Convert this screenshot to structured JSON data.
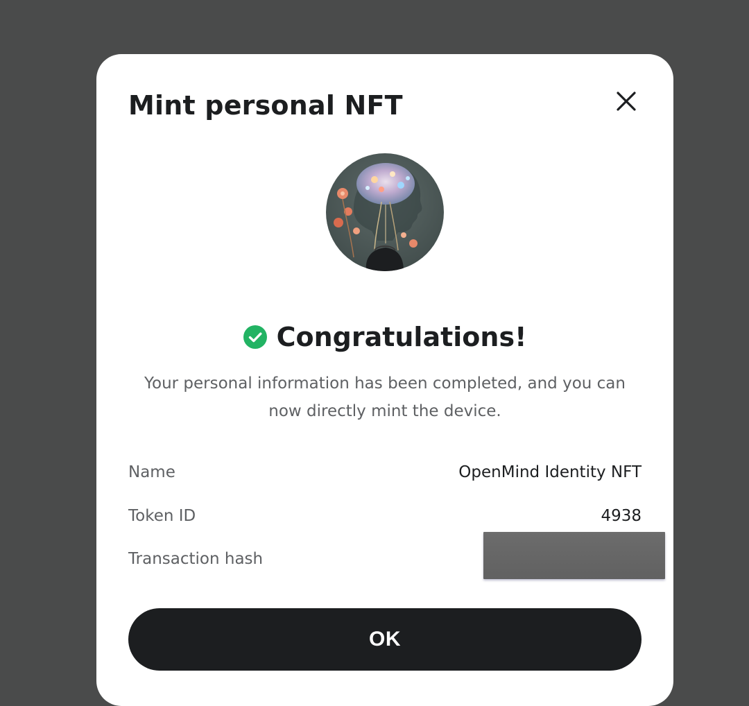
{
  "dialog": {
    "title": "Mint personal NFT",
    "close_icon": "close-icon"
  },
  "nft_image": {
    "icon": "brain-flowers-avatar",
    "colors": {
      "background": "#4d5a58",
      "brain": "#c9b7d8",
      "flowers": "#e8896a"
    }
  },
  "success": {
    "icon": "check-circle-icon",
    "icon_color": "#22b363",
    "headline": "Congratulations!",
    "message": "Your personal information has been completed, and you can now directly mint the device."
  },
  "details": [
    {
      "label": "Name",
      "value": "OpenMind Identity NFT"
    },
    {
      "label": "Token ID",
      "value": "4938"
    },
    {
      "label": "Transaction hash",
      "value": ""
    }
  ],
  "actions": {
    "ok_label": "OK"
  },
  "colors": {
    "overlay": "#4a4b4b",
    "surface": "#ffffff",
    "primary_button": "#1c1e20",
    "primary_text": "#1c1e20",
    "secondary_text": "#5e6063"
  }
}
